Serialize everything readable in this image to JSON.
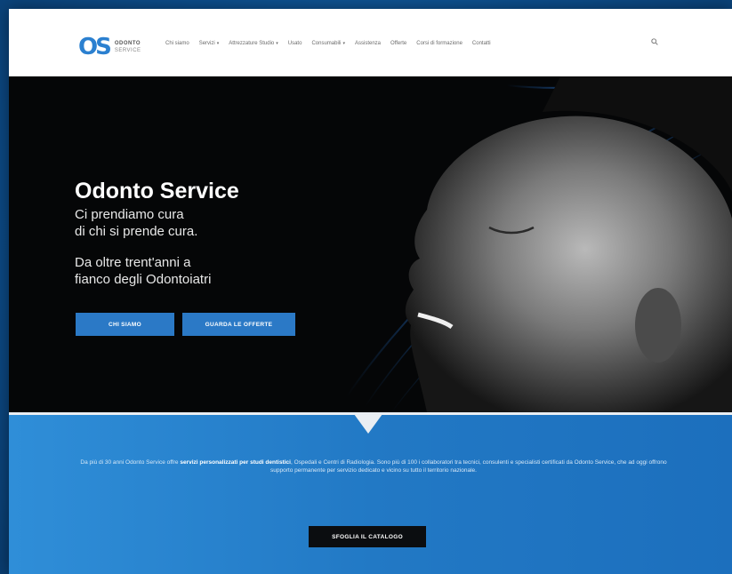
{
  "logo": {
    "mark": "OS",
    "name": "ODONTO",
    "sub": "SERVICE"
  },
  "nav": [
    {
      "label": "Chi siamo",
      "has_caret": false
    },
    {
      "label": "Servizi",
      "has_caret": true
    },
    {
      "label": "Attrezzature Studio",
      "has_caret": true
    },
    {
      "label": "Usato",
      "has_caret": false
    },
    {
      "label": "Consumabili",
      "has_caret": true
    },
    {
      "label": "Assistenza",
      "has_caret": false
    },
    {
      "label": "Offerte",
      "has_caret": false
    },
    {
      "label": "Corsi di formazione",
      "has_caret": false
    },
    {
      "label": "Contatti",
      "has_caret": false
    }
  ],
  "hero": {
    "title": "Odonto Service",
    "tagline": "Ci prendiamo cura\ndi chi si prende cura.",
    "tagline2": "Da oltre trent'anni a\nfianco degli Odontoiatri",
    "btn_who": "CHI SIAMO",
    "btn_offers": "GUARDA LE OFFERTE"
  },
  "intro": {
    "pre": "Da più di 30 anni Odonto Service offre ",
    "bold": "servizi personalizzati per studi dentistici",
    "post": ", Ospedali e Centri di Radiologia. Sono più di 100 i collaboratori tra tecnici, consulenti e specialisti certificati da Odonto Service, che ad oggi offrono supporto permanente per servizio dedicato e vicino su tutto il territorio nazionale."
  },
  "catalog_button": "SFOGLIA IL CATALOGO",
  "colors": {
    "accent": "#2b79c6",
    "band": "#2279c5",
    "hero_bg": "#050607"
  }
}
